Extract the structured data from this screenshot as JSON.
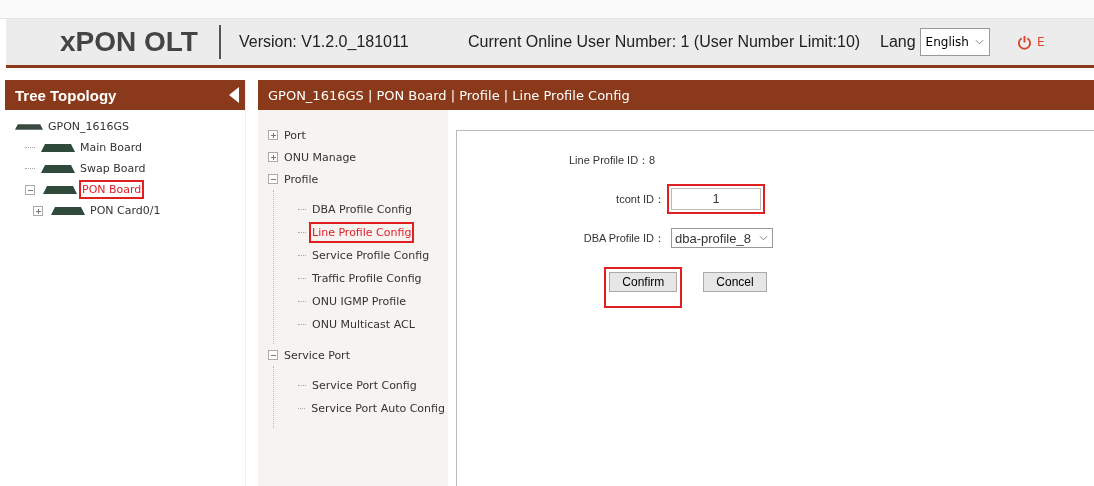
{
  "header": {
    "logo": "xPON OLT",
    "version": "Version: V1.2.0_181011",
    "online_users": "Current Online User Number: 1 (User Number Limit:10)",
    "lang_label": "Lang",
    "lang_value": "English",
    "logout_text": "E"
  },
  "sidebar": {
    "title": "Tree Topology",
    "tree": [
      {
        "label": "GPON_1616GS",
        "selected": false,
        "highlighted": false,
        "children": [
          {
            "label": "Main Board",
            "selected": false,
            "highlighted": false
          },
          {
            "label": "Swap Board",
            "selected": false,
            "highlighted": false
          },
          {
            "label": "PON Board",
            "selected": true,
            "highlighted": true,
            "expanded": true,
            "children": [
              {
                "label": "PON Card0/1",
                "selected": false,
                "highlighted": false,
                "expanded": false
              }
            ]
          }
        ]
      }
    ]
  },
  "breadcrumb": "GPON_1616GS | PON Board | Profile | Line Profile Config",
  "menu": [
    {
      "label": "Port",
      "expanded": false
    },
    {
      "label": "ONU Manage",
      "expanded": false
    },
    {
      "label": "Profile",
      "expanded": true,
      "children": [
        {
          "label": "DBA Profile Config",
          "selected": false,
          "highlighted": false
        },
        {
          "label": "Line Profile Config",
          "selected": true,
          "highlighted": true
        },
        {
          "label": "Service Profile Config",
          "selected": false,
          "highlighted": false
        },
        {
          "label": "Traffic Profile Config",
          "selected": false,
          "highlighted": false
        },
        {
          "label": "ONU IGMP Profile",
          "selected": false,
          "highlighted": false
        },
        {
          "label": "ONU Multicast ACL",
          "selected": false,
          "highlighted": false
        }
      ]
    },
    {
      "label": "Service Port",
      "expanded": true,
      "children": [
        {
          "label": "Service Port Config",
          "selected": false,
          "highlighted": false
        },
        {
          "label": "Service Port Auto Config",
          "selected": false,
          "highlighted": false
        }
      ]
    }
  ],
  "form": {
    "fields": [
      {
        "kind": "text",
        "label": "Line Profile ID：8",
        "highlighted": false
      },
      {
        "kind": "input",
        "label": "tcont ID：",
        "value": "1",
        "highlighted": true
      },
      {
        "kind": "select",
        "label": "DBA Profile ID：",
        "value": "dba-profile_8",
        "highlighted": false
      }
    ],
    "buttons": [
      {
        "label": "Confirm",
        "highlighted": true
      },
      {
        "label": "Concel",
        "highlighted": false
      }
    ]
  }
}
